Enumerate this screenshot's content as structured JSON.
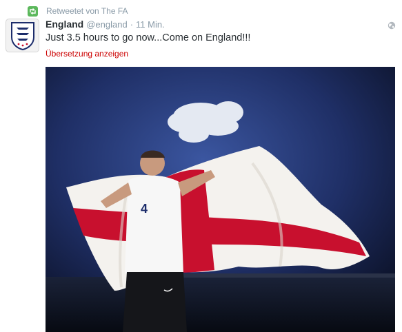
{
  "retweet": {
    "text": "Retweetet von The FA",
    "icon": "retweet-icon",
    "icon_color": "#5cb85c"
  },
  "tweet": {
    "author_name": "England",
    "handle": "@england",
    "separator": "·",
    "time": "11 Min.",
    "text": "Just 3.5 hours to go now...Come on England!!!",
    "translate_label": "Übersetzung anzeigen",
    "translate_color": "#cc0000"
  },
  "media": {
    "shirt_number": "4",
    "description_icon": "photo"
  },
  "colors": {
    "name": "#292f33",
    "meta": "#8899a6",
    "flag_red": "#c8102e"
  }
}
